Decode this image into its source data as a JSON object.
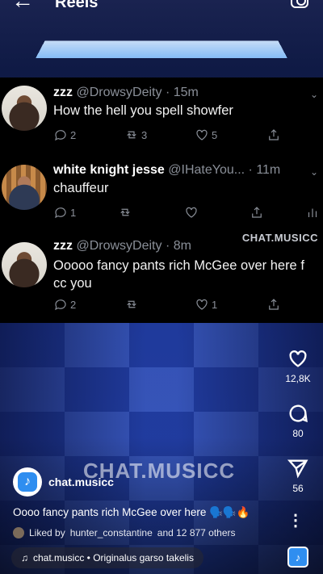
{
  "header": {
    "title": "Reels",
    "back_icon": "arrow-left-icon",
    "camera_icon": "camera-icon"
  },
  "tweets": [
    {
      "name": "zzz",
      "handle": "@DrowsyDeity",
      "time": "· 15m",
      "text": "How the hell you spell showfer",
      "replies": "2",
      "retweets": "3",
      "likes": "5"
    },
    {
      "name": "white knight jesse",
      "handle": "@IHateYou...",
      "time": "· 11m",
      "text": "chauffeur",
      "replies": "1",
      "retweets": "",
      "likes": ""
    },
    {
      "name": "zzz",
      "handle": "@DrowsyDeity",
      "time": "· 8m",
      "text": "Ooooo fancy pants rich McGee over here f  cc you",
      "replies": "2",
      "retweets": "",
      "likes": "1"
    }
  ],
  "watermark": "CHAT.MUSICC",
  "rail": {
    "likes": "12,8K",
    "comments": "80",
    "shares": "56"
  },
  "creator": {
    "name": "chat.musicc"
  },
  "caption": "Oooo fancy pants rich McGee over here 🗣️🗣️🔥",
  "liked_by": {
    "prefix": "Liked by",
    "user": "hunter_constantine",
    "suffix": "and 12 877 others"
  },
  "audio": "chat.musicc • Originalus garso takelis",
  "colors": {
    "accent": "#2f8ef0",
    "tweet_bg": "#000000",
    "muted": "#8a8f98"
  }
}
